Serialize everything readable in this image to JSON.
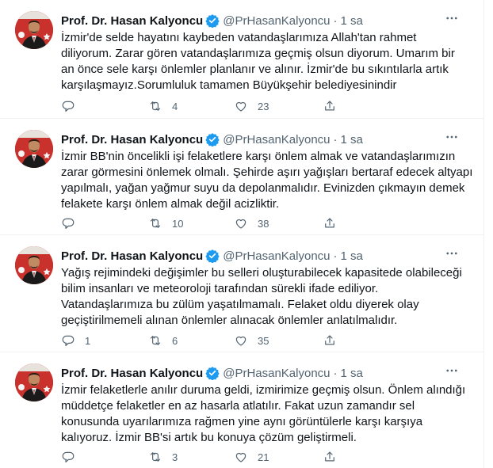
{
  "author": {
    "name": "Prof. Dr. Hasan Kalyoncu",
    "handle": "@PrHasanKalyoncu",
    "separator": "·",
    "time": "1 sa"
  },
  "icons": {
    "verified": "verified-badge-icon",
    "more": "more-options-icon",
    "reply": "reply-icon",
    "retweet": "retweet-icon",
    "like": "like-heart-icon",
    "share": "share-icon"
  },
  "colors": {
    "accent": "#1d9bf0",
    "text": "#0f1419",
    "muted": "#536471",
    "avatar_bg": "#c9312c"
  },
  "tweets": [
    {
      "lines": [
        "İzmir'de selde hayatını kaybeden vatandaşlarımıza Allah'tan rahmet",
        "diliyorum. Zarar gören vatandaşlarımıza geçmiş olsun diyorum. Umarım bir",
        "an önce sele karşı önlemler planlanır ve alınır. İzmir'de bu sıkıntılarla artık",
        "karşılaşmayız.Sorumluluk tamamen Büyükşehir belediyesinindir"
      ],
      "replies": "",
      "retweets": "4",
      "likes": "23"
    },
    {
      "lines": [
        "İzmir BB'nin öncelikli işi felaketlere karşı önlem almak ve vatandaşlarımızın",
        "zarar görmesini önlemek olmalı. Şehirde aşırı yağışları bertaraf edecek altyapı",
        "yapılmalı, yağan yağmur suyu da depolanmalıdır. Evinizden çıkmayın demek",
        "felakete karşı önlem almak değil acizliktir."
      ],
      "replies": "",
      "retweets": "10",
      "likes": "38"
    },
    {
      "lines": [
        "Yağış rejimindeki değişimler bu selleri oluşturabilecek kapasitede olabileceği",
        "bilim insanları ve meteoroloji tarafından sürekli ifade ediliyor.",
        "Vatandaşlarımıza bu zülüm yaşatılmamalı. Felaket oldu diyerek olay",
        "geçiştirilmemeli alınan önlemler alınacak önlemler anlatılmalıdır."
      ],
      "replies": "1",
      "retweets": "6",
      "likes": "35"
    },
    {
      "lines": [
        "İzmir felaketlerle anılır duruma geldi, izmirimize geçmiş olsun. Önlem alındığı",
        "müddetçe felaketler en az hasarla atlatılır. Fakat uzun zamandır sel",
        "konusunda uyarılarımıza rağmen yine aynı görüntülerle karşı karşıya",
        "kalıyoruz. İzmir BB'si artık bu konuya çözüm geliştirmeli."
      ],
      "replies": "",
      "retweets": "3",
      "likes": "21"
    }
  ]
}
